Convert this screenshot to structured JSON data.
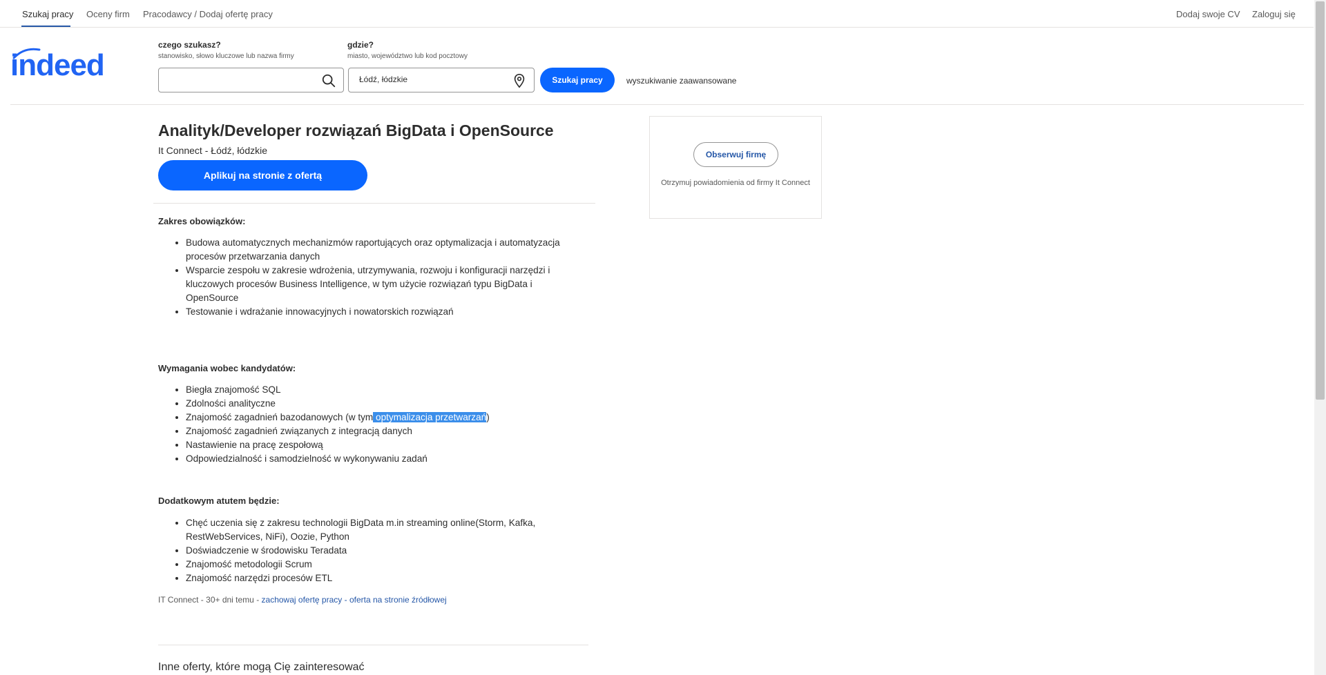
{
  "nav": {
    "left": [
      "Szukaj pracy",
      "Oceny firm",
      "Pracodawcy / Dodaj ofertę pracy"
    ],
    "right": [
      "Dodaj swoje CV",
      "Zaloguj się"
    ]
  },
  "logo": "indeed",
  "search": {
    "what_label": "czego szukasz?",
    "what_hint": "stanowisko, słowo kluczowe lub nazwa firmy",
    "what_value": "",
    "where_label": "gdzie?",
    "where_hint": "miasto, województwo lub kod pocztowy",
    "where_value": "Łódź, łódzkie",
    "button": "Szukaj pracy",
    "advanced": "wyszukiwanie zaawansowane"
  },
  "job": {
    "title": "Analityk/Developer rozwiązań BigData i OpenSource",
    "company": "It Connect",
    "meta_sep": " - ",
    "location": "Łódź, łódzkie",
    "apply": "Aplikuj na stronie z ofertą",
    "sections": [
      {
        "heading": "Zakres obowiązków:",
        "items": [
          "Budowa automatycznych mechanizmów raportujących oraz optymalizacja i automatyzacja procesów przetwarzania danych",
          "Wsparcie zespołu w zakresie wdrożenia, utrzymywania, rozwoju i konfiguracji narzędzi i kluczowych procesów Business Intelligence, w tym użycie rozwiązań typu BigData i OpenSource",
          "Testowanie i wdrażanie innowacyjnych i nowatorskich rozwiązań"
        ]
      },
      {
        "heading": "Wymagania wobec kandydatów:",
        "items": [
          "Biegła znajomość SQL",
          "Zdolności analityczne",
          "Znajomość zagadnień bazodanowych (w tym",
          "Znajomość zagadnień związanych z integracją danych",
          "Nastawienie na pracę zespołową",
          "Odpowiedzialność i samodzielność w wykonywaniu zadań"
        ],
        "highlight_text": " optymalizacja przetwarzań",
        "highlight_tail": ")"
      },
      {
        "heading": "Dodatkowym atutem będzie:",
        "items": [
          "Chęć uczenia się z zakresu technologii BigData m.in streaming online(Storm, Kafka, RestWebServices, NiFi), Oozie, Python",
          "Doświadczenie w środowisku Teradata",
          "Znajomość metodologii Scrum",
          "Znajomość narzędzi procesów ETL"
        ]
      }
    ],
    "footer_prefix": "IT Connect - 30+ dni temu - ",
    "footer_save": "zachowaj ofertę pracy",
    "footer_mid": " - ",
    "footer_source": "oferta na stronie źródłowej",
    "others_heading": "Inne oferty, które mogą Cię zainteresować"
  },
  "company_card": {
    "follow": "Obserwuj firmę",
    "note": "Otrzymuj powiadomienia od firmy It Connect"
  },
  "colors": {
    "primary": "#0a66ff",
    "link": "#2557a7",
    "highlight": "#3b8eea"
  }
}
